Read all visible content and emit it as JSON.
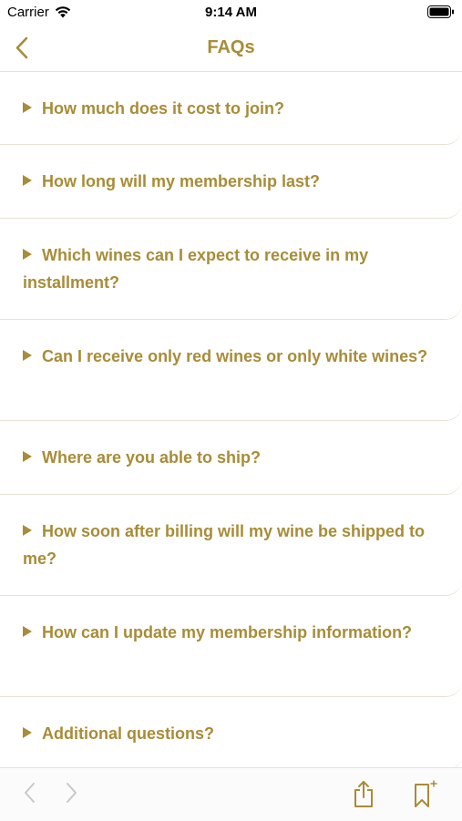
{
  "status_bar": {
    "carrier": "Carrier",
    "time": "9:14 AM"
  },
  "nav": {
    "title": "FAQs",
    "back_icon": "chevron-left-icon"
  },
  "faqs": [
    "How much does it cost to join?",
    "How long will my membership last?",
    "Which wines can I expect to receive in my installment?",
    "Can I receive only red wines or only white wines?",
    "Where are you able to ship?",
    "How soon after billing will my wine be shipped to me?",
    "How can I update my membership information?",
    "Additional questions?"
  ],
  "toolbar": {
    "back_icon": "chevron-left-icon",
    "forward_icon": "chevron-right-icon",
    "share_icon": "share-icon",
    "bookmark_icon": "bookmark-add-icon"
  },
  "colors": {
    "accent": "#a88c37",
    "divider": "#e7e2d3"
  }
}
